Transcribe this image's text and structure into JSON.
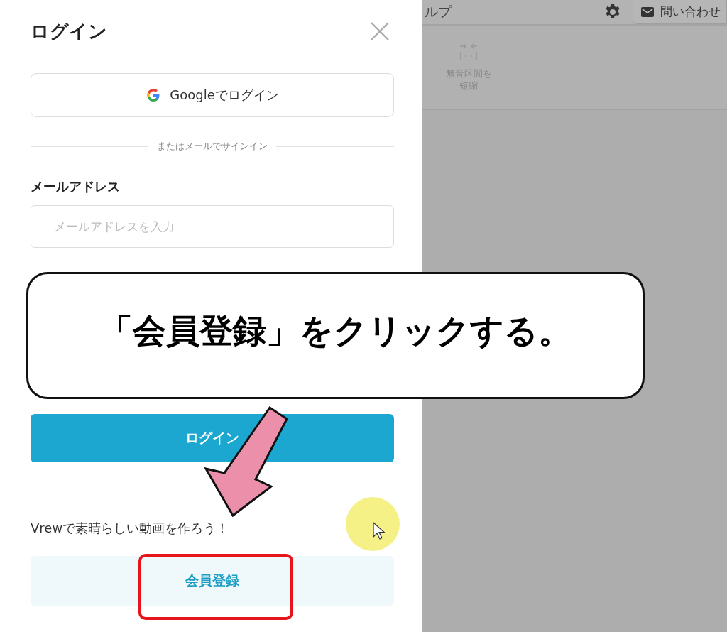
{
  "app": {
    "menu_partial": "ルプ",
    "contact_button": "問い合わせ",
    "toolbar": [
      {
        "label_lines": [
          "無音区間を",
          "短縮"
        ]
      }
    ]
  },
  "login": {
    "title": "ログイン",
    "google_button": "Googleでログイン",
    "divider": "またはメールでサインイン",
    "email_label": "メールアドレス",
    "email_placeholder": "メールアドレスを入力",
    "login_button": "ログイン",
    "promo": "Vrewで素晴らしい動画を作ろう！",
    "signup_button": "会員登録"
  },
  "callout": {
    "text": "「会員登録」をクリックする。"
  }
}
